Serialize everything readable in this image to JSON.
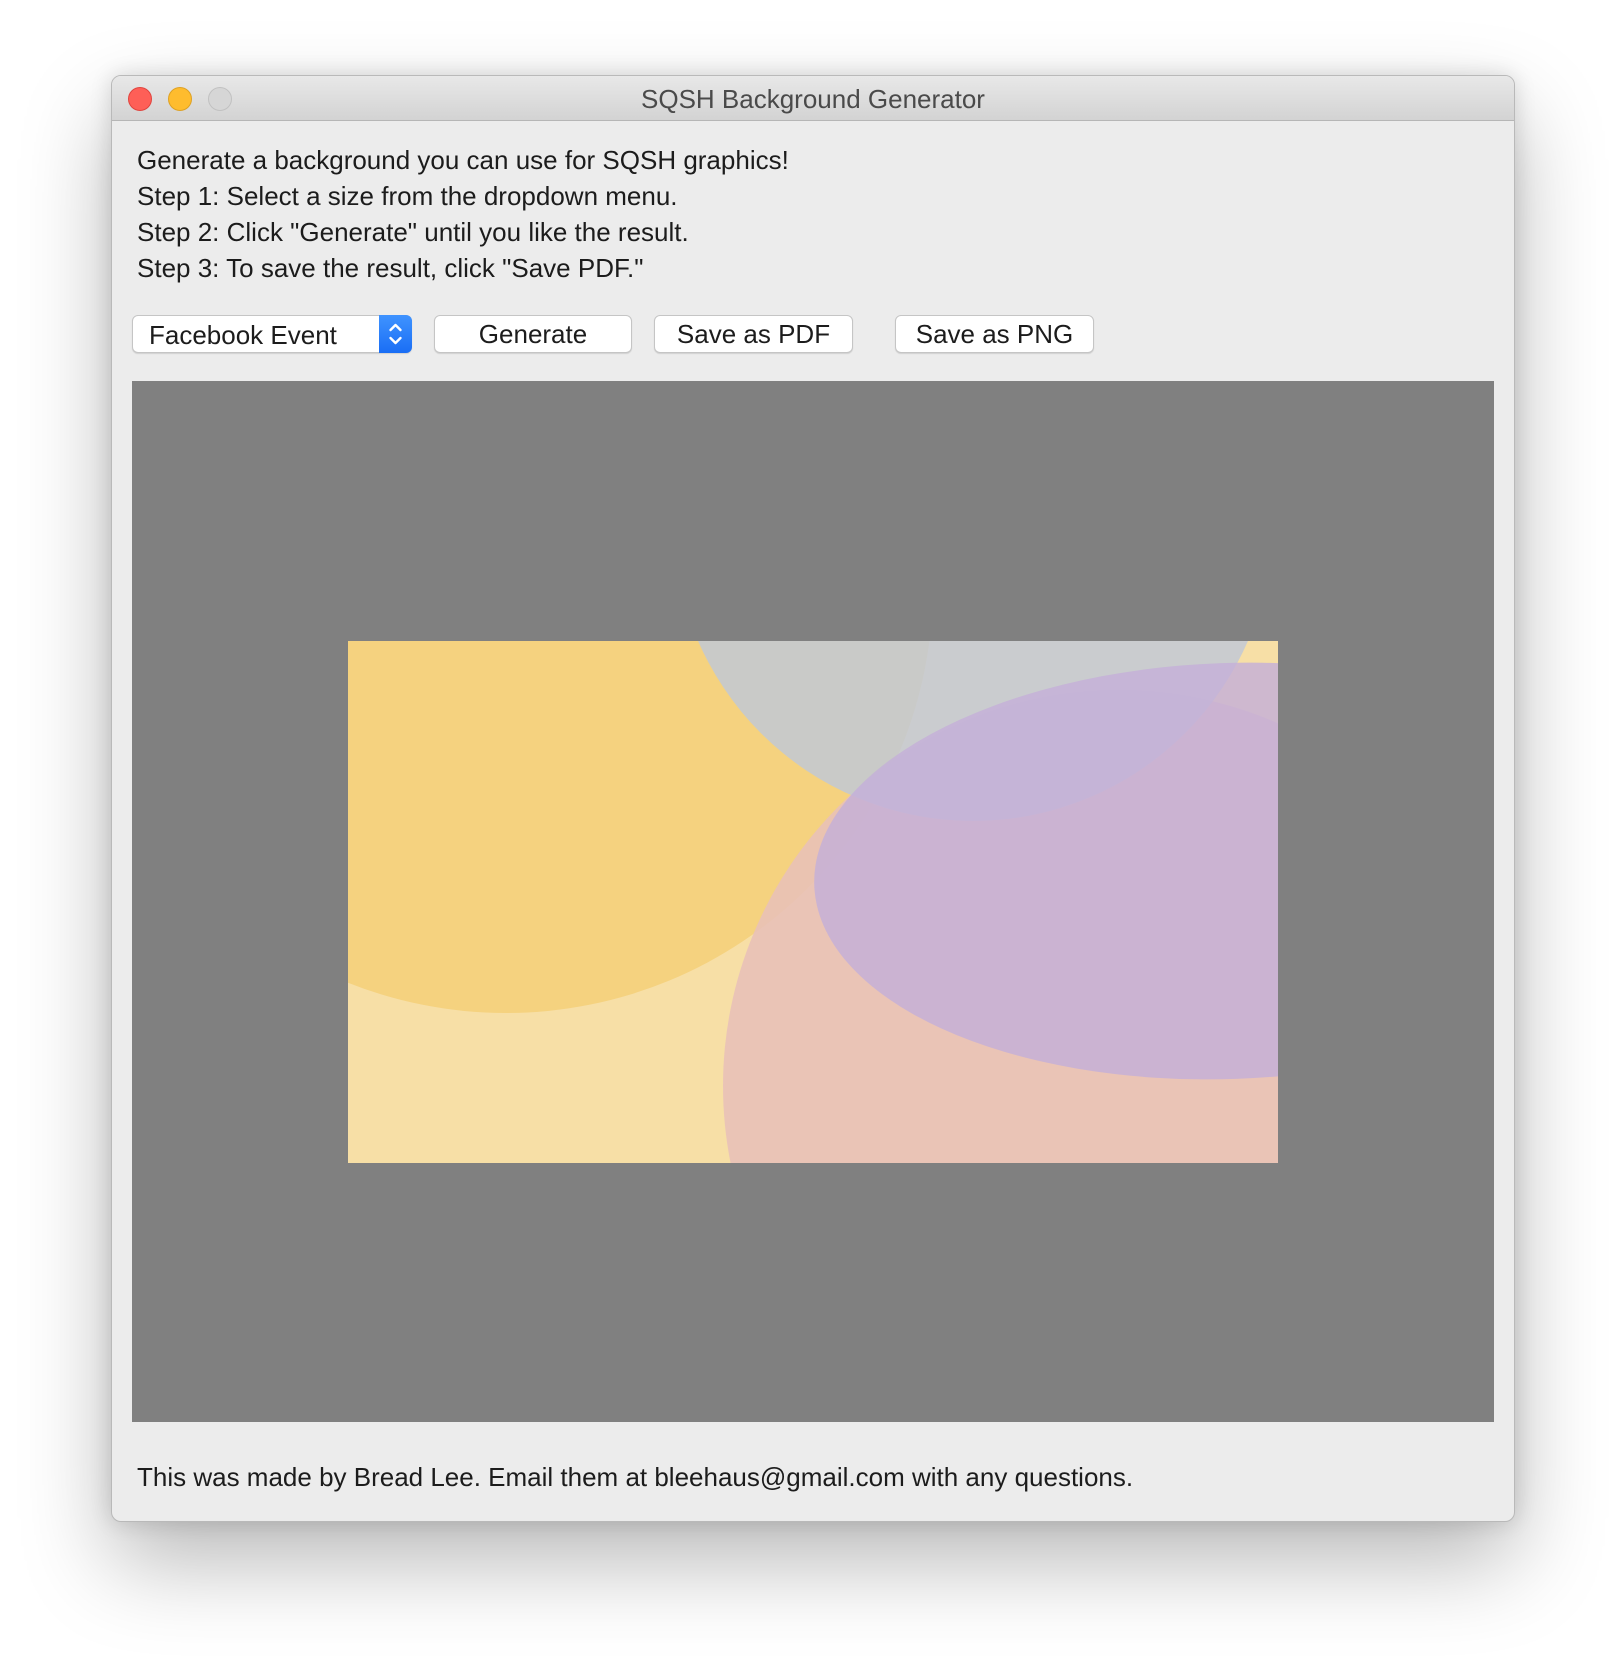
{
  "window": {
    "title": "SQSH Background Generator"
  },
  "instructions": [
    "Generate a background you can use for SQSH graphics!",
    "Step 1: Select a size from the dropdown menu.",
    "Step 2: Click \"Generate\" until you like the result.",
    "Step 3: To save the result, click \"Save PDF.\""
  ],
  "controls": {
    "size_select": {
      "selected": "Facebook Event",
      "icon": "updown-chevron-icon"
    },
    "generate_label": "Generate",
    "save_pdf_label": "Save as PDF",
    "save_png_label": "Save as PNG"
  },
  "preview": {
    "background_color": "#808080",
    "image_base_color": "#f7dfa6",
    "circle_colors": [
      "#f5d27f",
      "#e8c0b8",
      "#c0c8d8",
      "#c5b3d3"
    ]
  },
  "footer": {
    "text": "This was made by Bread Lee. Email them at bleehaus@gmail.com with any questions."
  },
  "colors": {
    "close": "#fe5f57",
    "minimize": "#febc2e",
    "zoom_inactive": "#d6d6d6",
    "accent": "#1a6ef5"
  }
}
